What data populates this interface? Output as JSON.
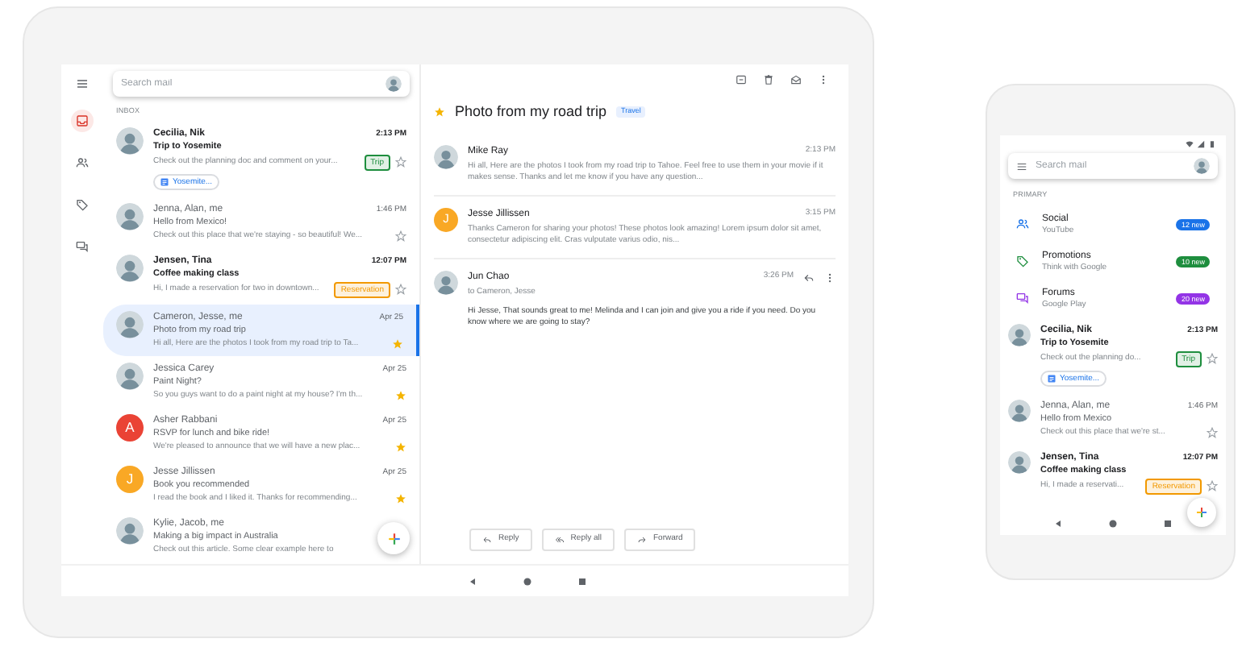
{
  "tablet": {
    "search": {
      "placeholder": "Search mail"
    },
    "sidebar": [
      {
        "kind": "inbox",
        "selected": true
      },
      {
        "kind": "people",
        "selected": false
      },
      {
        "kind": "tag",
        "selected": false
      },
      {
        "kind": "chat",
        "selected": false
      }
    ],
    "section": "INBOX",
    "list": [
      {
        "avatar": {
          "kind": "photo"
        },
        "sender": "Cecilia, Nik",
        "time": "2:13 PM",
        "subject": "Trip to Yosemite",
        "snippet": "Check out the planning doc and comment on your...",
        "tag": {
          "text": "Trip",
          "color": "#1e8e3e"
        },
        "attachment": "Yosemite...",
        "unread": true,
        "starred": false,
        "selected": false
      },
      {
        "avatar": {
          "kind": "photo"
        },
        "sender": "Jenna, Alan, me",
        "time": "1:46 PM",
        "subject": "Hello from Mexico!",
        "snippet": "Check out this place that we're staying - so beautiful! We...",
        "unread": false,
        "starred": false,
        "selected": false
      },
      {
        "avatar": {
          "kind": "photo"
        },
        "sender": "Jensen, Tina",
        "time": "12:07 PM",
        "subject": "Coffee making class",
        "snippet": "Hi, I made a reservation for two in downtown...",
        "tag": {
          "text": "Reservation",
          "color": "#f29900"
        },
        "unread": true,
        "starred": false,
        "selected": false
      },
      {
        "avatar": {
          "kind": "photo"
        },
        "sender": "Cameron, Jesse, me",
        "time": "Apr 25",
        "subject": "Photo from my road trip",
        "snippet": "Hi all, Here are the photos I took from my road trip to Ta...",
        "unread": false,
        "starred": true,
        "selected": true
      },
      {
        "avatar": {
          "kind": "photo"
        },
        "sender": "Jessica Carey",
        "time": "Apr 25",
        "subject": "Paint Night?",
        "snippet": "So you guys want to do a paint night at my house? I'm th...",
        "unread": false,
        "starred": true,
        "selected": false
      },
      {
        "avatar": {
          "kind": "letter",
          "letter": "A",
          "color": "#ea4335"
        },
        "sender": "Asher Rabbani",
        "time": "Apr 25",
        "subject": "RSVP for lunch and bike ride!",
        "snippet": "We're pleased to announce that we will have a new plac...",
        "unread": false,
        "starred": true,
        "selected": false
      },
      {
        "avatar": {
          "kind": "letter",
          "letter": "J",
          "color": "#f9a825"
        },
        "sender": "Jesse Jillissen",
        "time": "Apr 25",
        "subject": "Book you recommended",
        "snippet": "I read the book and I liked it. Thanks for recommending...",
        "unread": false,
        "starred": true,
        "selected": false
      },
      {
        "avatar": {
          "kind": "photo"
        },
        "sender": "Kylie, Jacob, me",
        "subject": "Making a big impact in Australia",
        "snippet": "Check out this article. Some clear example here to",
        "unread": false,
        "selected": false
      }
    ],
    "thread": {
      "subject": "Photo from my road trip",
      "label": "Travel",
      "starred": true,
      "messages": [
        {
          "avatar": {
            "kind": "photo"
          },
          "sender": "Mike Ray",
          "time": "2:13 PM",
          "body": "Hi all, Here are the photos I took from my road trip to Tahoe. Feel free to use them in your movie if it makes sense. Thanks and let me know if you have any question..."
        },
        {
          "avatar": {
            "kind": "letter",
            "letter": "J",
            "color": "#f9a825"
          },
          "sender": "Jesse Jillissen",
          "time": "3:15 PM",
          "body": "Thanks Cameron for sharing your photos! These photos look amazing! Lorem ipsum dolor sit amet, consectetur adipiscing elit. Cras vulputate varius odio, nis..."
        },
        {
          "avatar": {
            "kind": "photo"
          },
          "sender": "Jun Chao",
          "time": "3:26 PM",
          "to": "to Cameron, Jesse",
          "body": "Hi Jesse, That sounds great to me! Melinda and I can join and give you a ride if you need. Do you know where we are going to stay?"
        }
      ],
      "actions": [
        {
          "kind": "reply",
          "label": "Reply"
        },
        {
          "kind": "reply_all",
          "label": "Reply all"
        },
        {
          "kind": "forward",
          "label": "Forward"
        }
      ]
    }
  },
  "phone": {
    "search": {
      "placeholder": "Search mail"
    },
    "section": "PRIMARY",
    "categories": [
      {
        "kind": "social",
        "name": "Social",
        "source": "YouTube",
        "badge": "12 new",
        "color": "#1a73e8"
      },
      {
        "kind": "promotions",
        "name": "Promotions",
        "source": "Think with Google",
        "badge": "10 new",
        "color": "#1e8e3e"
      },
      {
        "kind": "forums",
        "name": "Forums",
        "source": "Google Play",
        "badge": "20 new",
        "color": "#9334e6"
      }
    ],
    "list": [
      {
        "avatar": {
          "kind": "photo"
        },
        "sender": "Cecilia, Nik",
        "time": "2:13 PM",
        "subject": "Trip to Yosemite",
        "snippet": "Check out the planning do...",
        "tag": {
          "text": "Trip",
          "color": "#1e8e3e"
        },
        "attachment": "Yosemite...",
        "unread": true,
        "starred": false
      },
      {
        "avatar": {
          "kind": "photo"
        },
        "sender": "Jenna, Alan, me",
        "time": "1:46 PM",
        "subject": "Hello from Mexico",
        "snippet": "Check out this place that we're st...",
        "unread": false,
        "starred": false
      },
      {
        "avatar": {
          "kind": "photo"
        },
        "sender": "Jensen, Tina",
        "time": "12:07 PM",
        "subject": "Coffee making class",
        "snippet": "Hi, I made a reservati...",
        "tag": {
          "text": "Reservation",
          "color": "#f29900"
        },
        "unread": true,
        "starred": false
      }
    ]
  }
}
